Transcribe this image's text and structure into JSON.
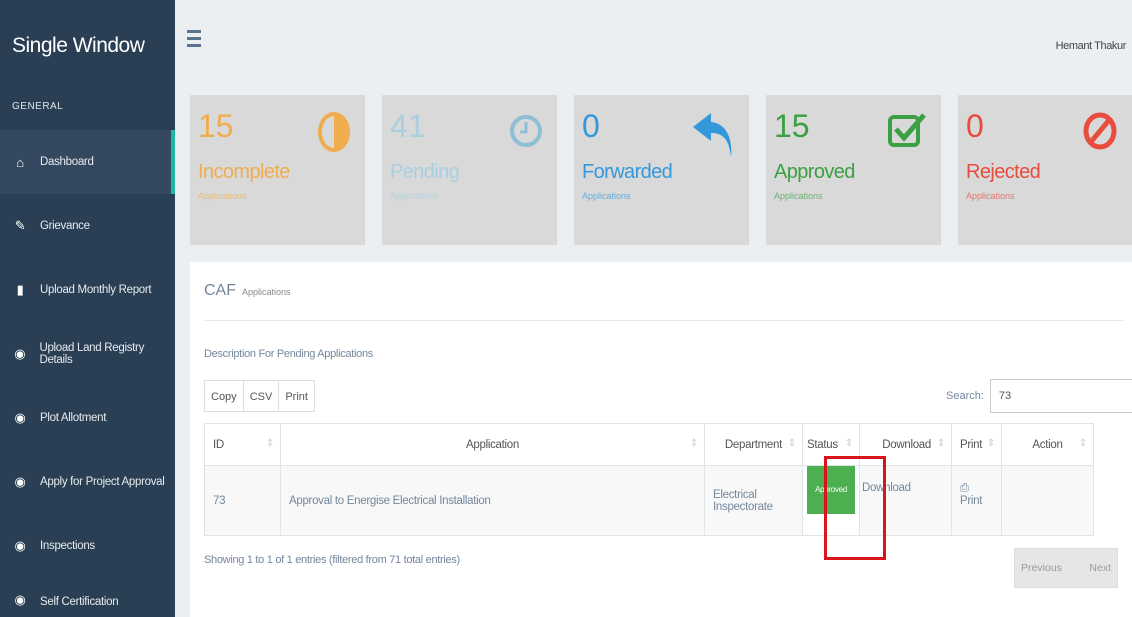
{
  "brand": "Single Window",
  "sidebar": {
    "section": "GENERAL",
    "items": [
      {
        "label": "Dashboard",
        "icon": "home-icon"
      },
      {
        "label": "Grievance",
        "icon": "pencil-icon"
      },
      {
        "label": "Upload Monthly Report",
        "icon": "bar-chart-icon"
      },
      {
        "label": "Upload Land Registry Details",
        "icon": "location-icon"
      },
      {
        "label": "Plot Allotment",
        "icon": "location-icon"
      },
      {
        "label": "Apply for Project Approval",
        "icon": "location-icon"
      },
      {
        "label": "Inspections",
        "icon": "location-icon"
      },
      {
        "label": "Self Certification",
        "icon": "location-icon"
      }
    ]
  },
  "topbar": {
    "user": "Hemant Thakur"
  },
  "tiles": [
    {
      "num": "15",
      "label": "Incomplete",
      "sub": "Applications",
      "icon": "half-circle-icon",
      "color": "#f0ad4e"
    },
    {
      "num": "41",
      "label": "Pending",
      "sub": "Applications",
      "icon": "clock-icon",
      "color": "#a9cfe0"
    },
    {
      "num": "0",
      "label": "Forwarded",
      "sub": "Applications",
      "icon": "reply-icon",
      "color": "#3498db"
    },
    {
      "num": "15",
      "label": "Approved",
      "sub": "Applications",
      "icon": "check-square-icon",
      "color": "#3aa043"
    },
    {
      "num": "0",
      "label": "Rejected",
      "sub": "Applications",
      "icon": "ban-icon",
      "color": "#e74c3c"
    }
  ],
  "panel": {
    "title": "CAF",
    "subtitle": "Applications",
    "description": "Description For Pending Applications",
    "buttons": [
      "Copy",
      "CSV",
      "Print"
    ],
    "search_label": "Search:",
    "search_value": "73",
    "columns": [
      "ID",
      "Application",
      "Department",
      "Status",
      "Download",
      "Print",
      "Action"
    ],
    "row": {
      "id": "73",
      "application": "Approval to Energise Electrical Installation",
      "department_line1": "Electrical",
      "department_line2": "Inspectorate",
      "status": "Approved",
      "download": "Download",
      "print": "Print",
      "action": ""
    },
    "info": "Showing 1 to 1 of 1 entries (filtered from 71 total entries)",
    "prev": "Previous",
    "next": "Next"
  }
}
